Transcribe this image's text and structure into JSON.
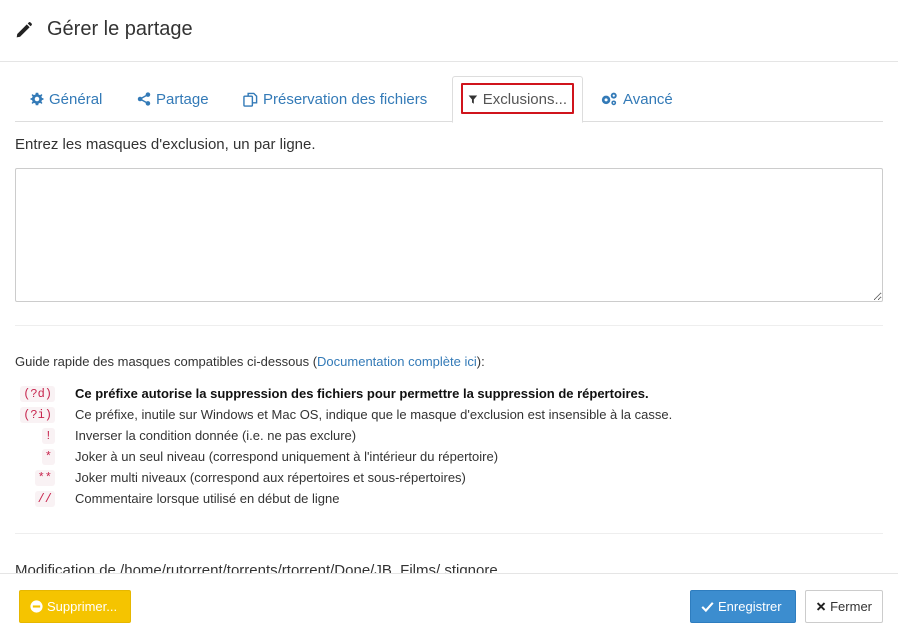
{
  "dialog": {
    "title": "Gérer le partage"
  },
  "tabs": [
    {
      "label": "Général"
    },
    {
      "label": "Partage"
    },
    {
      "label": "Préservation des fichiers"
    },
    {
      "label": "Exclusions..."
    },
    {
      "label": "Avancé"
    }
  ],
  "exclusions": {
    "intro": "Entrez les masques d'exclusion, un par ligne.",
    "textarea_value": "",
    "guide_prefix": "Guide rapide des masques compatibles ci-dessous (",
    "guide_link": "Documentation complète ici",
    "guide_suffix": "):",
    "rules": [
      {
        "code": "(?d)",
        "desc": "Ce préfixe autorise la suppression des fichiers pour permettre la suppression de répertoires."
      },
      {
        "code": "(?i)",
        "desc": "Ce préfixe, inutile sur Windows et Mac OS, indique que le masque d'exclusion est insensible à la casse."
      },
      {
        "code": "!",
        "desc": "Inverser la condition donnée (i.e. ne pas exclure)"
      },
      {
        "code": "*",
        "desc": "Joker à un seul niveau (correspond uniquement à l'intérieur du répertoire)"
      },
      {
        "code": "**",
        "desc": "Joker multi niveaux (correspond aux répertoires et sous-répertoires)"
      },
      {
        "code": "//",
        "desc": "Commentaire lorsque utilisé en début de ligne"
      }
    ],
    "modification": "Modification de /home/rutorrent/torrents/rtorrent/Done/JB_Films/.stignore."
  },
  "footer": {
    "delete_label": "Supprimer...",
    "save_label": "Enregistrer",
    "close_label": "Fermer"
  },
  "colors": {
    "link": "#337ab7",
    "delete_btn": "#f5c400",
    "save_btn": "#3c8dcf",
    "highlight": "#d0141c",
    "code_text": "#c7254e"
  }
}
